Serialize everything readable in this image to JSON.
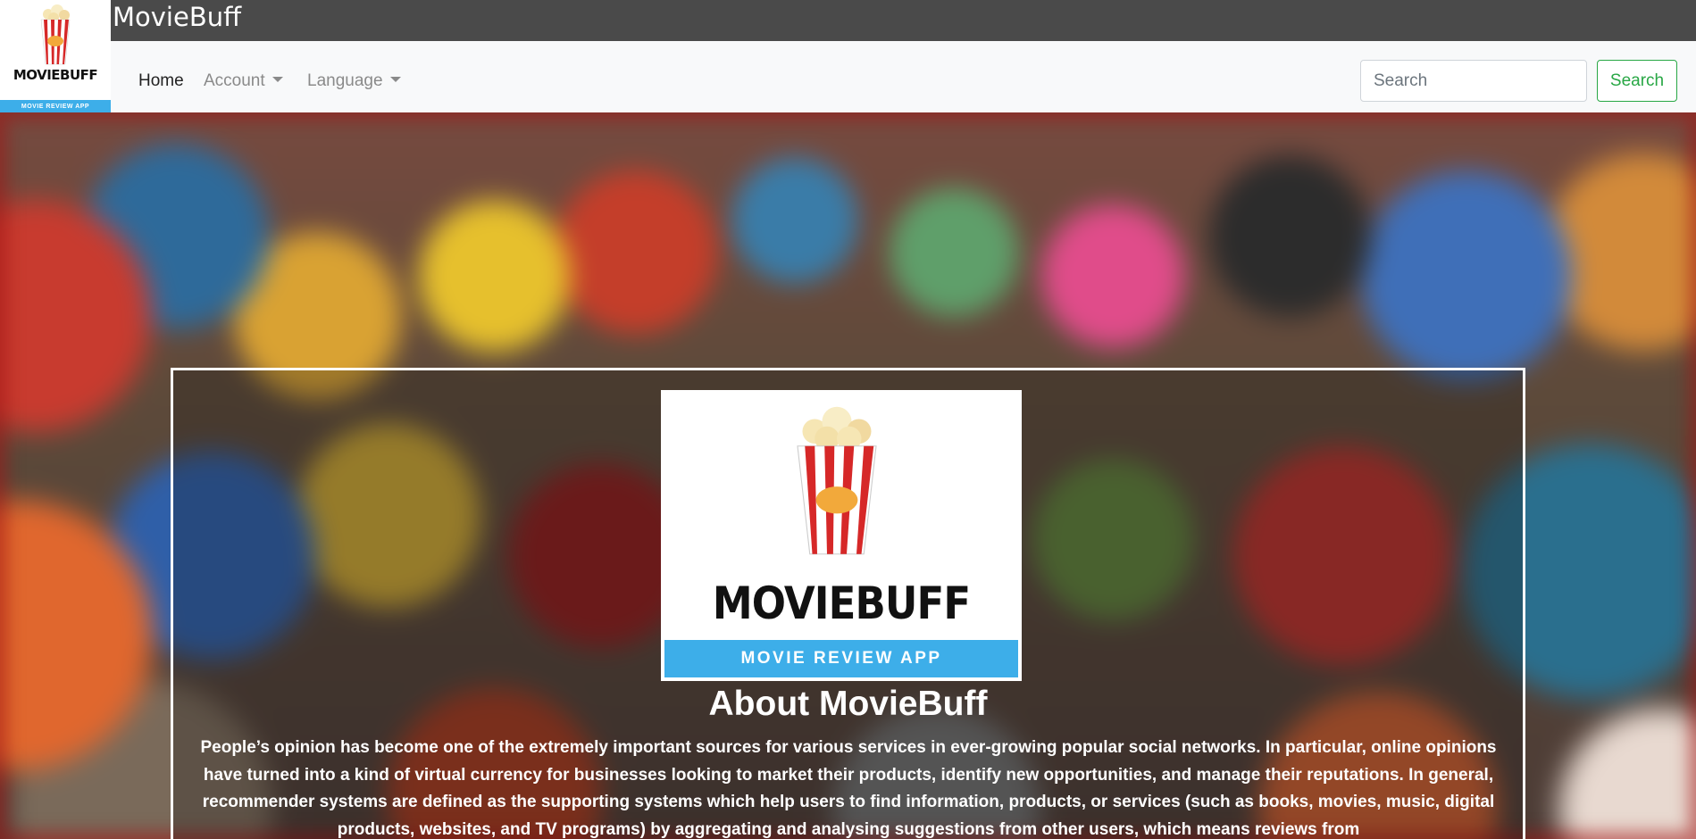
{
  "app": {
    "title": "MovieBuff",
    "logo_word": "MOVIEBUFF",
    "logo_tagline": "MOVIE REVIEW APP"
  },
  "nav": {
    "home": "Home",
    "account": "Account",
    "language": "Language"
  },
  "search": {
    "placeholder": "Search",
    "button": "Search"
  },
  "about": {
    "title": "About MovieBuff",
    "text": "People’s opinion has become one of the extremely important sources for various services in ever-growing popular social networks. In particular, online opinions have turned into a kind of virtual currency for businesses looking to market their products, identify new opportunities, and manage their reputations. In general, recommender systems are defined as the supporting systems which help users to find information, products, or services (such as books, movies, music, digital products, websites, and TV programs) by aggregating and analysing suggestions from other users, which means reviews from"
  },
  "colors": {
    "title_bar": "#4a4a4a",
    "navbar": "#f8f9fa",
    "search_button": "#28a745",
    "logo_band": "#3daee9",
    "popcorn_stripe": "#d62828"
  },
  "icons": {
    "caret": "chevron-down-icon",
    "logo": "popcorn-icon"
  }
}
